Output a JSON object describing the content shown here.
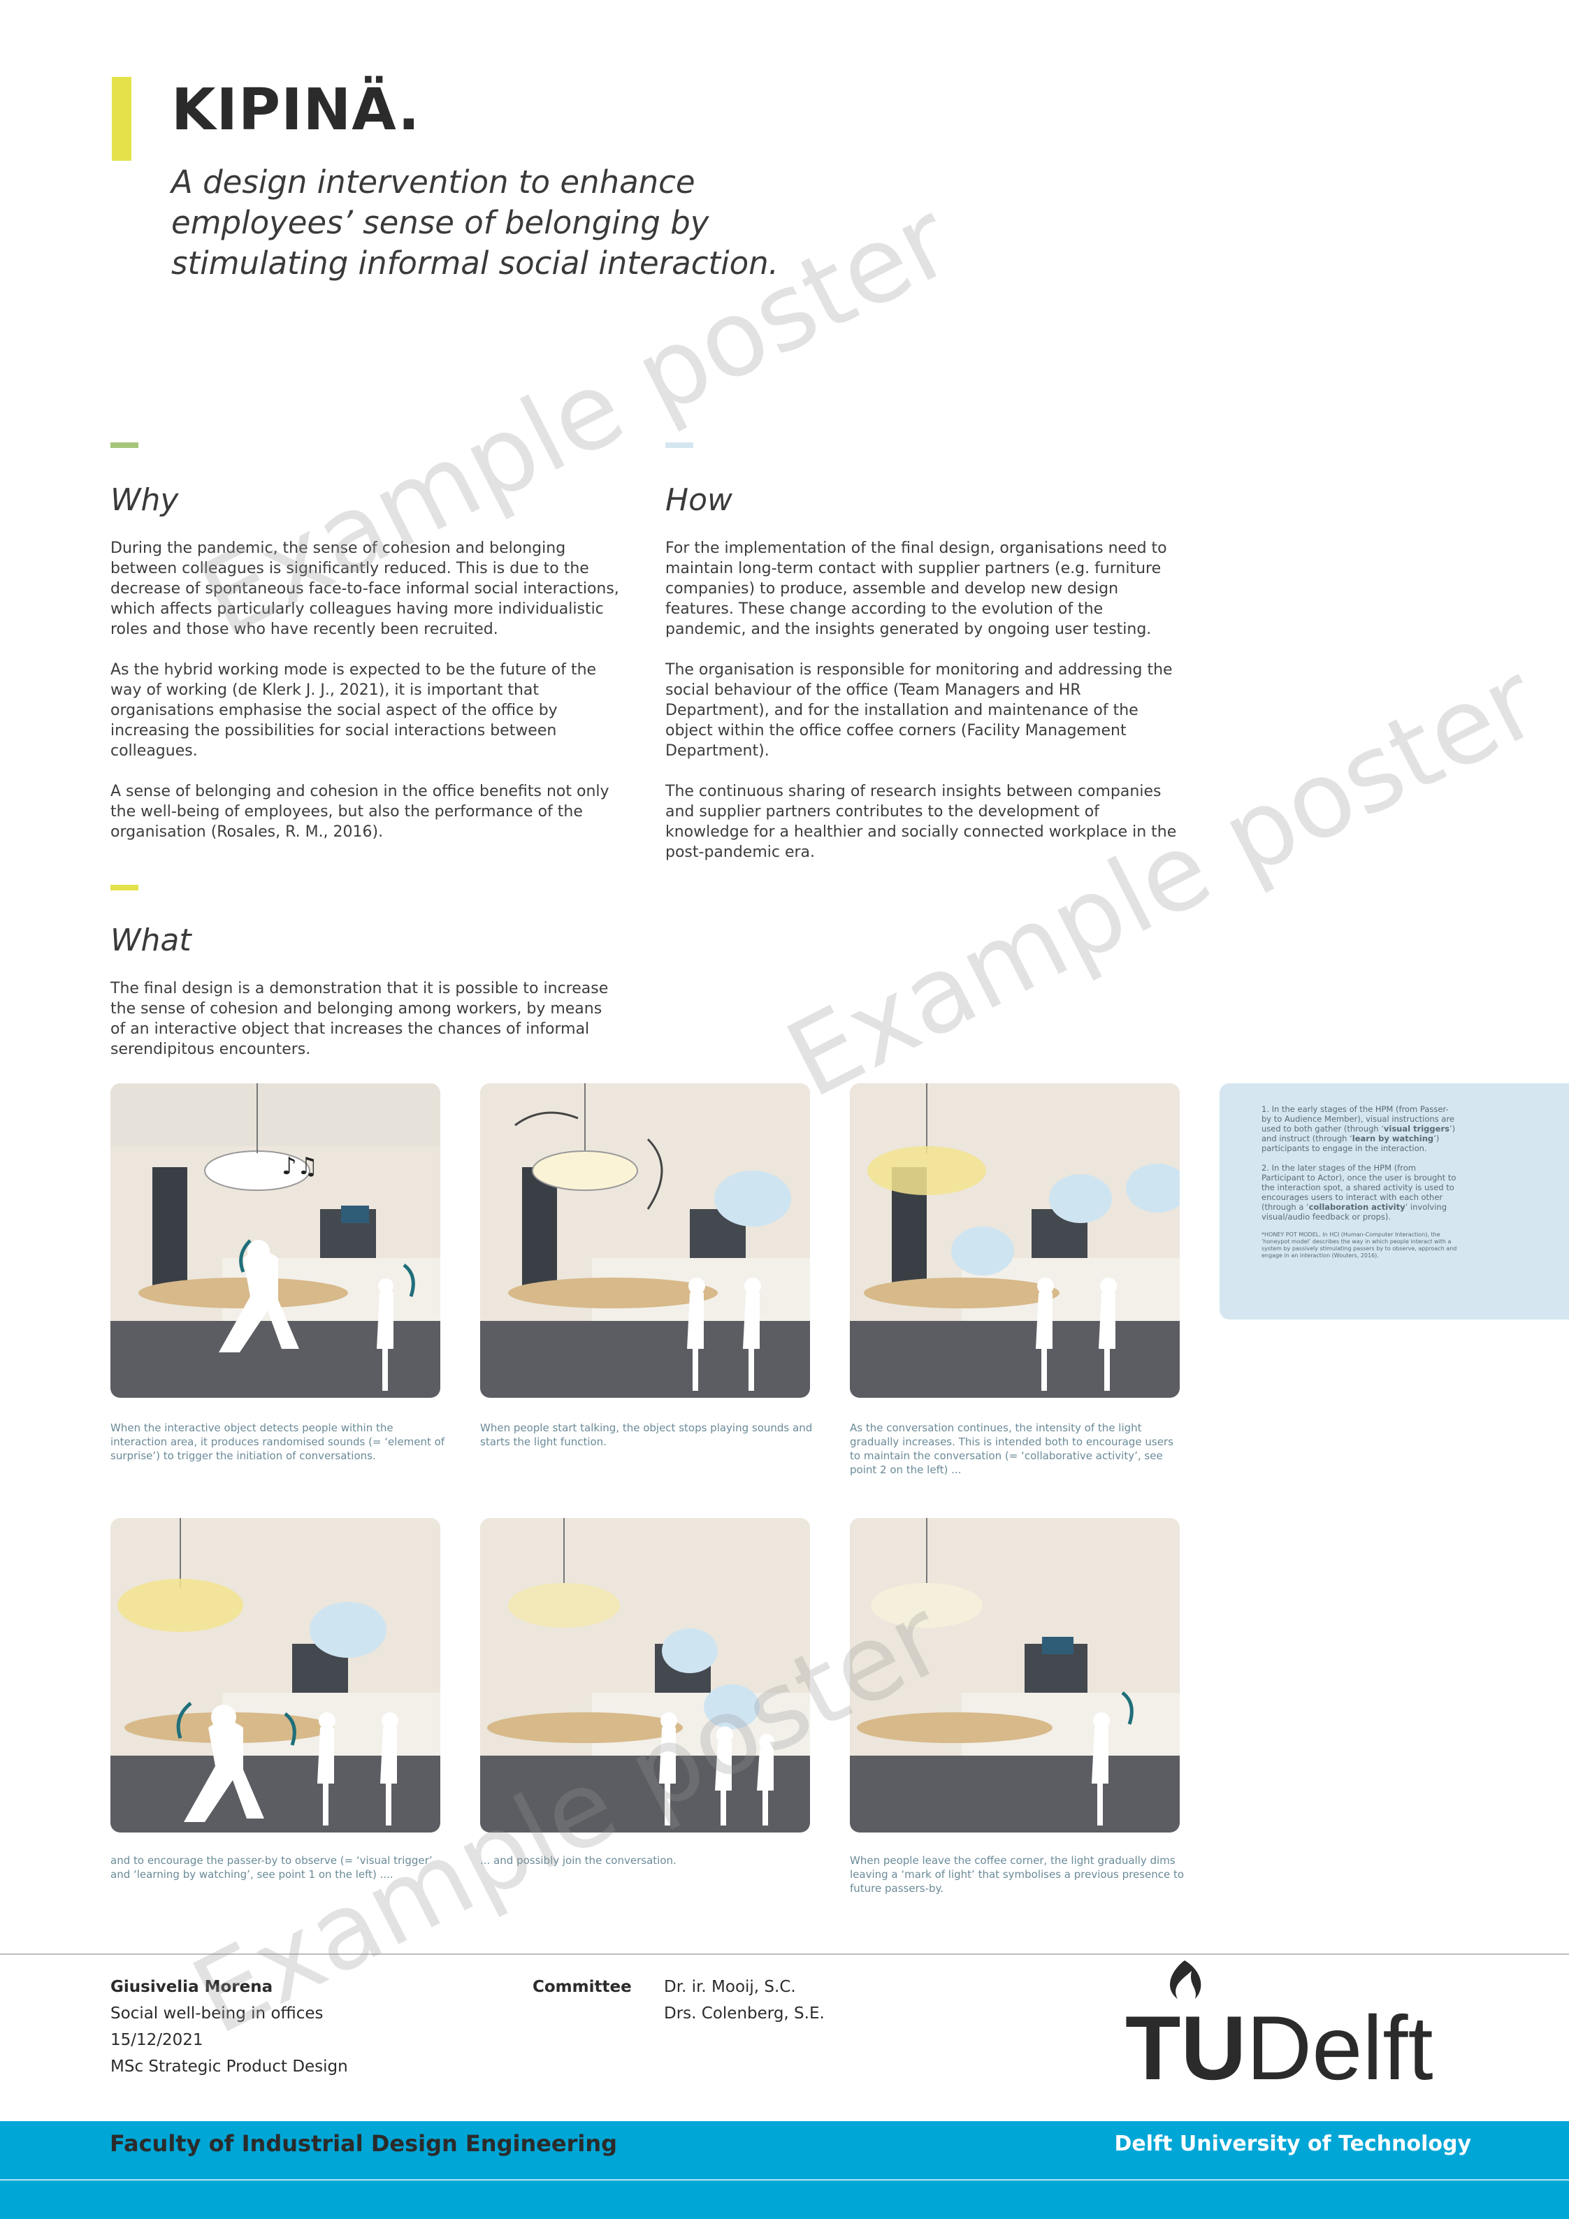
{
  "header": {
    "title": "KIPINÄ.",
    "subtitle": "A design intervention to enhance employees’ sense of belonging by stimulating informal social interaction."
  },
  "colors": {
    "yellow_accent": "#e3e24a",
    "green_accent": "#a5c67a",
    "blue_accent": "#d5e6f0",
    "tu_blue": "#00a6d6"
  },
  "why": {
    "title": "Why",
    "paragraphs": [
      "During the pandemic, the sense of cohesion and belonging between colleagues is significantly reduced. This is due to the decrease of spontaneous face-to-face informal social interactions, which affects particularly colleagues having more individualistic roles and those who have recently been recruited.",
      "As the hybrid working mode is expected to be the future of the way of working (de Klerk J. J., 2021), it is important that organisations emphasise the social aspect of the office by increasing the possibilities for social interactions between colleagues.",
      "A sense of belonging and cohesion in the office benefits not only the well-being of employees, but also the performance of the organisation (Rosales, R. M., 2016)."
    ]
  },
  "how": {
    "title": "How",
    "paragraphs": [
      "For the implementation of the final design, organisations need to maintain long-term contact with supplier partners (e.g. furniture companies) to produce, assemble and develop new design features. These change according to the evolution of the pandemic, and the insights generated by ongoing user testing.",
      "The organisation is responsible for monitoring and addressing the social behaviour of the office (Team Managers and HR Department), and for the installation and maintenance of the object within the office coffee corners (Facility Management Department).",
      "The continuous sharing of research insights between companies and supplier partners contributes to the development of knowledge for a healthier and socially connected workplace in the post-pandemic era."
    ]
  },
  "what": {
    "title": "What",
    "paragraph": "The final design is a demonstration that it is possible to increase the sense of cohesion and belonging among workers, by means of an interactive object that increases the chances of informal serendipitous encounters."
  },
  "captions": [
    "When the interactive object detects people within the interaction area, it produces randomised sounds (= ‘element of surprise’) to trigger the initiation of conversations.",
    "When people start talking, the object stops playing sounds and starts the light function.",
    "As the conversation continues, the intensity of the light gradually increases. This is intended both to encourage users to maintain the conversation (= ‘collaborative activity’, see point 2 on the left) ...",
    "and to encourage the passer-by to observe (= ‘visual trigger’ and ‘learning by watching’, see point 1 on the left) ....",
    "... and possibly join the conversation.",
    "When people leave the coffee corner, the light gradually dims leaving a ‘mark of light’ that symbolises a previous presence to future passers-by."
  ],
  "hpm": {
    "point1_pre": "1. In the early stages of the HPM (from Passer-by to Audience Member), visual instructions are used to both gather (through ‘",
    "point1_b1": "visual triggers",
    "point1_mid": "’) and instruct (through ‘",
    "point1_b2": "learn by watching",
    "point1_post": "’) participants to engage in the interaction.",
    "point2_pre": "2. In the later stages of the HPM (from Participant to Actor), once the user is brought to the interaction spot, a shared activity is used to encourages users to interact with each other (through a ‘",
    "point2_b": "collaboration activity",
    "point2_post": "’ involving visual/audio feedback or props).",
    "note": "*HONEY POT MODEL. In HCI (Human-Computer Interaction), the ‘honeypot model’ describes the way in which people interact with a system by passively stimulating passers by to observe, approach and engage in an interaction (Wouters, 2016)."
  },
  "footer": {
    "author": "Giusivelia Morena",
    "topic": "Social well-being in offices",
    "date": "15/12/2021",
    "programme": "MSc Strategic Product Design",
    "committee_label": "Committee",
    "committee": [
      "Dr. ir. Mooij, S.C.",
      "Drs. Colenberg, S.E."
    ],
    "faculty": "Faculty of Industrial Design Engineering",
    "university": "Delft University of Technology",
    "logo_tu": "TU",
    "logo_delft": "Delft"
  },
  "watermark": "Example poster"
}
